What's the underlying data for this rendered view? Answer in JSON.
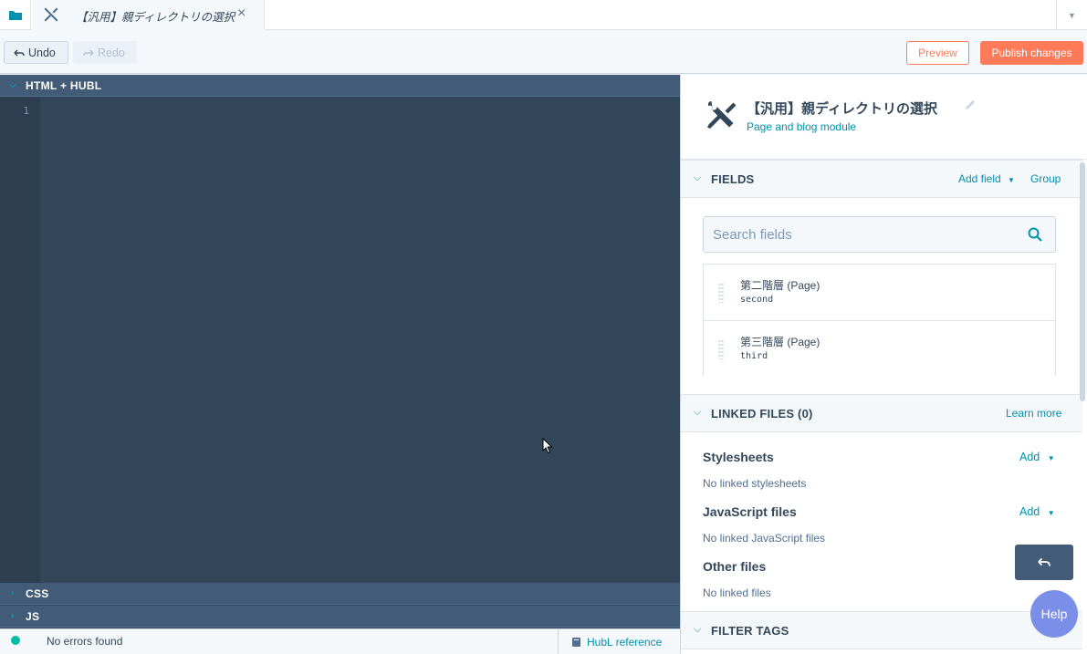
{
  "tabbar": {
    "tab_title": "【汎用】親ディレクトリの選択",
    "close_glyph": "×"
  },
  "toolbar": {
    "undo_label": "Undo",
    "redo_label": "Redo",
    "preview_label": "Preview",
    "publish_label": "Publish changes"
  },
  "editor": {
    "html_section": "HTML + HUBL",
    "line_number": "1",
    "css_section": "CSS",
    "js_section": "JS"
  },
  "statusbar": {
    "status_text": "No errors found",
    "hubl_reference": "HubL reference"
  },
  "panel": {
    "module_title": "【汎用】親ディレクトリの選択",
    "module_subtitle": "Page and blog module",
    "fields": {
      "title": "FIELDS",
      "add_field": "Add field",
      "group": "Group",
      "search_placeholder": "Search fields",
      "items": [
        {
          "name": "第二階層 (Page)",
          "key": "second"
        },
        {
          "name": "第三階層 (Page)",
          "key": "third"
        }
      ]
    },
    "linked_files": {
      "title": "LINKED FILES (0)",
      "learn_more": "Learn more",
      "stylesheets_title": "Stylesheets",
      "stylesheets_empty": "No linked stylesheets",
      "js_title": "JavaScript files",
      "js_empty": "No linked JavaScript files",
      "other_title": "Other files",
      "other_empty": "No linked files",
      "add_label": "Add"
    },
    "filter_tags": {
      "title": "FILTER TAGS"
    }
  },
  "help": {
    "label": "Help"
  },
  "colors": {
    "accent": "#ff7a59",
    "link": "#0091ae",
    "editor_bg": "#33475b",
    "status_ok": "#00bda5"
  },
  "icons": [
    "folder-icon",
    "tools-icon",
    "close-icon",
    "undo-icon",
    "redo-icon",
    "book-icon",
    "search-icon",
    "pencil-icon",
    "chevron-down-icon",
    "chevron-right-icon",
    "drag-handle-icon"
  ]
}
